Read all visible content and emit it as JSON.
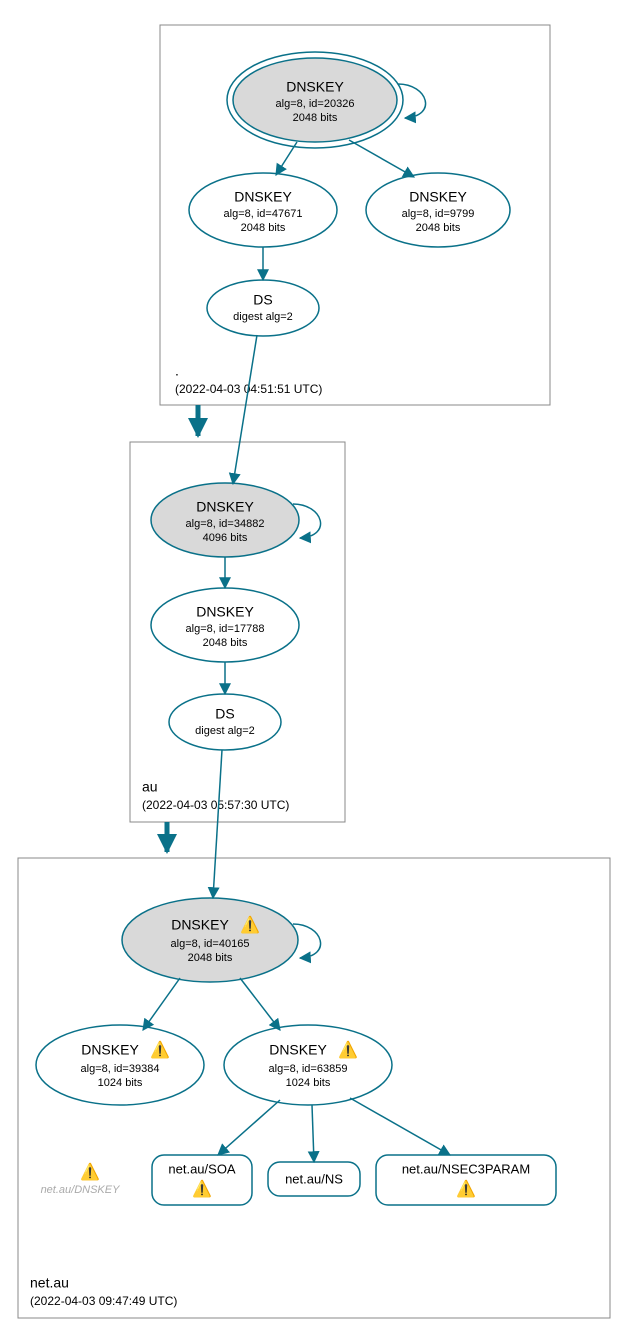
{
  "zones": {
    "root": {
      "label": ".",
      "timestamp": "(2022-04-03 04:51:51 UTC)"
    },
    "au": {
      "label": "au",
      "timestamp": "(2022-04-03 05:57:30 UTC)"
    },
    "netau": {
      "label": "net.au",
      "timestamp": "(2022-04-03 09:47:49 UTC)"
    }
  },
  "nodes": {
    "root_ksk": {
      "title": "DNSKEY",
      "l2": "alg=8, id=20326",
      "l3": "2048 bits"
    },
    "root_zsk1": {
      "title": "DNSKEY",
      "l2": "alg=8, id=47671",
      "l3": "2048 bits"
    },
    "root_zsk2": {
      "title": "DNSKEY",
      "l2": "alg=8, id=9799",
      "l3": "2048 bits"
    },
    "root_ds": {
      "title": "DS",
      "l2": "digest alg=2"
    },
    "au_ksk": {
      "title": "DNSKEY",
      "l2": "alg=8, id=34882",
      "l3": "4096 bits"
    },
    "au_zsk": {
      "title": "DNSKEY",
      "l2": "alg=8, id=17788",
      "l3": "2048 bits"
    },
    "au_ds": {
      "title": "DS",
      "l2": "digest alg=2"
    },
    "netau_ksk": {
      "title": "DNSKEY",
      "l2": "alg=8, id=40165",
      "l3": "2048 bits"
    },
    "netau_zsk1": {
      "title": "DNSKEY",
      "l2": "alg=8, id=39384",
      "l3": "1024 bits"
    },
    "netau_zsk2": {
      "title": "DNSKEY",
      "l2": "alg=8, id=63859",
      "l3": "1024 bits"
    },
    "soa": {
      "label": "net.au/SOA"
    },
    "ns": {
      "label": "net.au/NS"
    },
    "nsec3": {
      "label": "net.au/NSEC3PARAM"
    }
  },
  "ghost": {
    "label": "net.au/DNSKEY"
  },
  "warning_icon": "⚠️"
}
